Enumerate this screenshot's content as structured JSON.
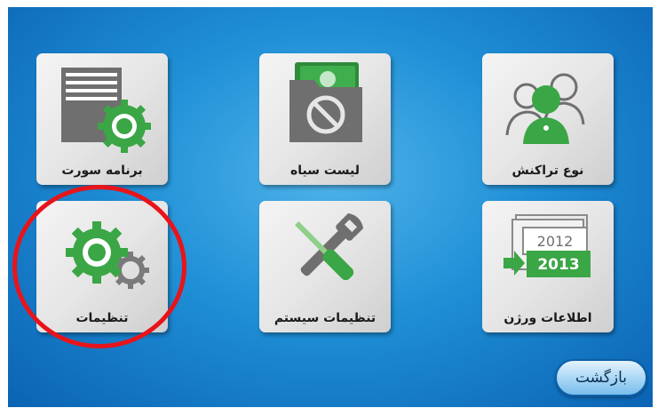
{
  "tiles": {
    "sort_program": {
      "label": "برنامه سورت",
      "icon": "document-gear-icon"
    },
    "blacklist": {
      "label": "لیست سیاه",
      "icon": "folder-blocked-icon"
    },
    "transaction_type": {
      "label": "نوع تراکنش",
      "icon": "users-icon"
    },
    "settings": {
      "label": "تنظیمات",
      "icon": "gears-icon"
    },
    "system_settings": {
      "label": "تنظیمات سیستم",
      "icon": "tools-icon"
    },
    "version_info": {
      "label": "اطلاعات ورژن",
      "icon": "calendar-version-icon",
      "old_year": "2012",
      "new_year": "2013"
    }
  },
  "back_button": {
    "label": "بازگشت"
  },
  "colors": {
    "background_center": "#4fb3ea",
    "background_edge": "#0b63b4",
    "accent_green": "#3aa645",
    "highlight_red": "#e8141a"
  }
}
